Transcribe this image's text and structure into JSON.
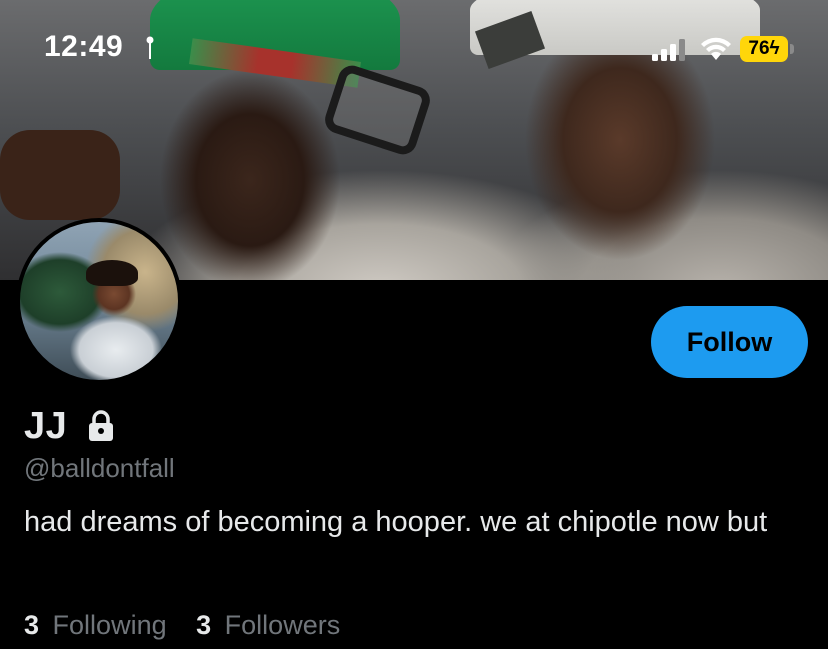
{
  "status_bar": {
    "time": "12:49",
    "battery": "76",
    "battery_color": "#ffd60a"
  },
  "banner": {
    "image": "header-photo-two-men-in-caps"
  },
  "profile": {
    "display_name": "JJ",
    "handle": "@balldontfall",
    "bio": "had dreams of becoming a hooper. we at chipotle now but",
    "protected_icon": "lock-icon",
    "avatar": "profile-photo"
  },
  "actions": {
    "follow_label": "Follow",
    "follow_color": "#1d9bf0"
  },
  "stats": {
    "following_count": "3",
    "following_label": "Following",
    "followers_count": "3",
    "followers_label": "Followers"
  }
}
